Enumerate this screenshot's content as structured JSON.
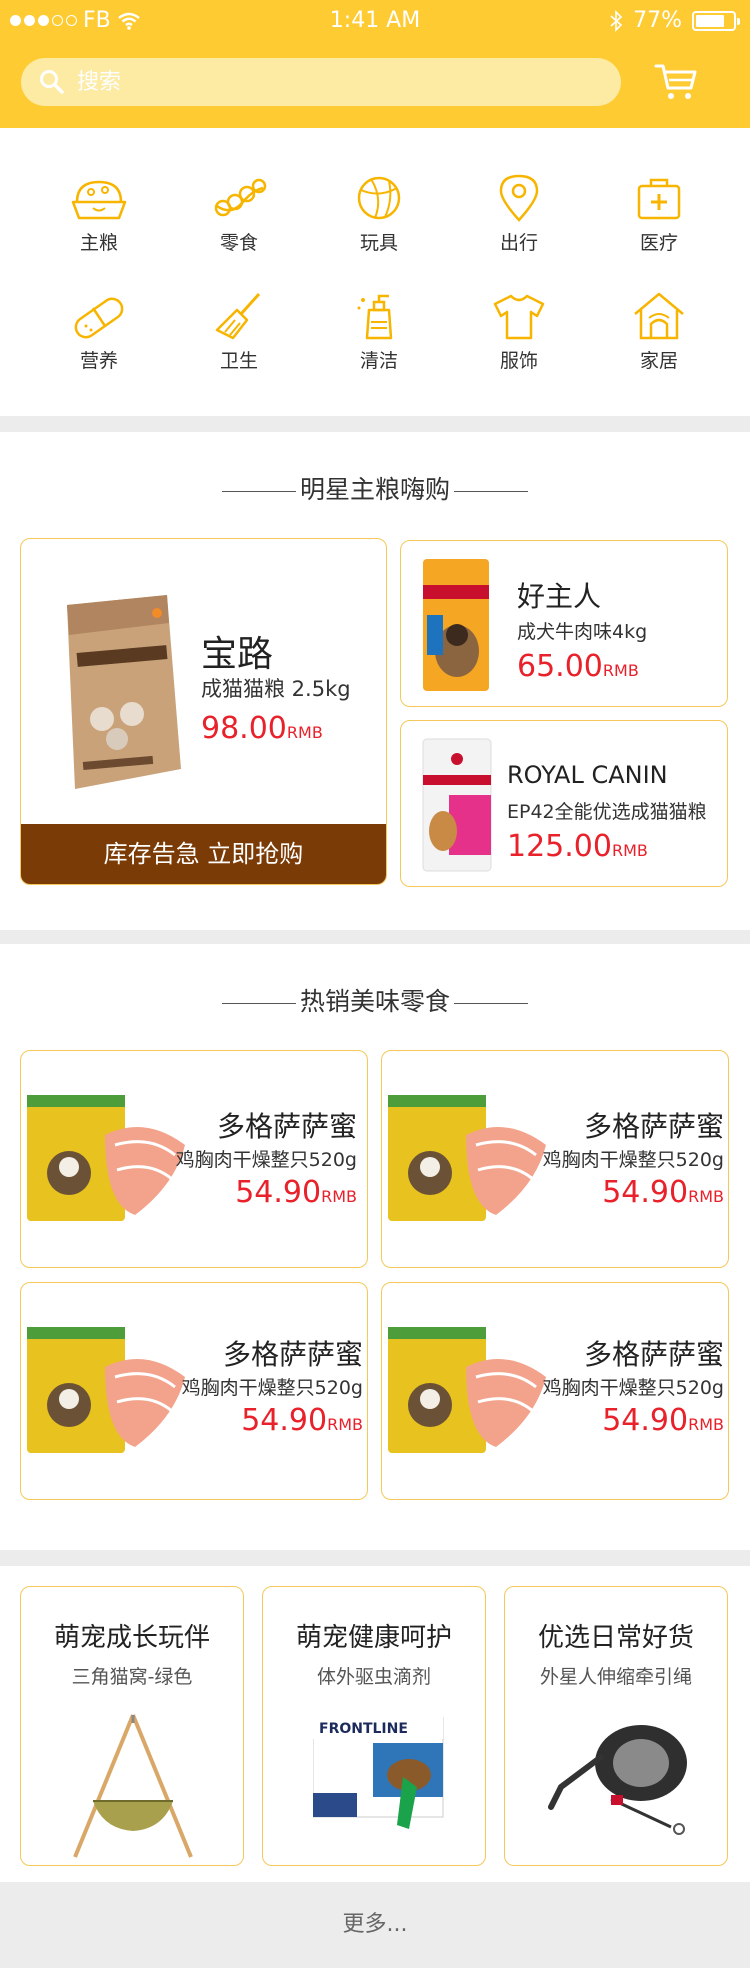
{
  "status": {
    "carrier": "FB",
    "time": "1:41 AM",
    "battery": "77%",
    "battery_level": 0.77
  },
  "search": {
    "placeholder": "搜索"
  },
  "categories": [
    {
      "label": "主粮",
      "icon": "food-bowl-icon"
    },
    {
      "label": "零食",
      "icon": "snack-icon"
    },
    {
      "label": "玩具",
      "icon": "ball-icon"
    },
    {
      "label": "出行",
      "icon": "location-icon"
    },
    {
      "label": "医疗",
      "icon": "medical-kit-icon"
    },
    {
      "label": "营养",
      "icon": "capsule-icon"
    },
    {
      "label": "卫生",
      "icon": "broom-icon"
    },
    {
      "label": "清洁",
      "icon": "soap-bottle-icon"
    },
    {
      "label": "服饰",
      "icon": "tshirt-icon"
    },
    {
      "label": "家居",
      "icon": "pet-house-icon"
    }
  ],
  "staple": {
    "title": "明星主粮嗨购",
    "featured": {
      "brand": "宝路",
      "desc": "成猫猫粮 2.5kg",
      "price": "98.00",
      "unit": "RMB",
      "banner": "库存告急 立即抢购"
    },
    "items": [
      {
        "brand": "好主人",
        "desc": "成犬牛肉味4kg",
        "price": "65.00",
        "unit": "RMB"
      },
      {
        "brand": "ROYAL CANIN",
        "desc": "EP42全能优选成猫猫粮",
        "price": "125.00",
        "unit": "RMB"
      }
    ]
  },
  "snacks": {
    "title": "热销美味零食",
    "items": [
      {
        "name": "多格萨萨蜜",
        "desc": "鸡胸肉干燥整只520g",
        "price": "54.90",
        "unit": "RMB"
      },
      {
        "name": "多格萨萨蜜",
        "desc": "鸡胸肉干燥整只520g",
        "price": "54.90",
        "unit": "RMB"
      },
      {
        "name": "多格萨萨蜜",
        "desc": "鸡胸肉干燥整只520g",
        "price": "54.90",
        "unit": "RMB"
      },
      {
        "name": "多格萨萨蜜",
        "desc": "鸡胸肉干燥整只520g",
        "price": "54.90",
        "unit": "RMB"
      }
    ]
  },
  "promos": [
    {
      "title": "萌宠成长玩伴",
      "subtitle": "三角猫窝-绿色"
    },
    {
      "title": "萌宠健康呵护",
      "subtitle": "体外驱虫滴剂"
    },
    {
      "title": "优选日常好货",
      "subtitle": "外星人伸缩牵引绳"
    }
  ],
  "more": "更多...",
  "colors": {
    "brand_yellow": "#fecb33",
    "price_red": "#e8212a",
    "banner_brown": "#7b3b06",
    "card_border": "#f5c85a"
  }
}
